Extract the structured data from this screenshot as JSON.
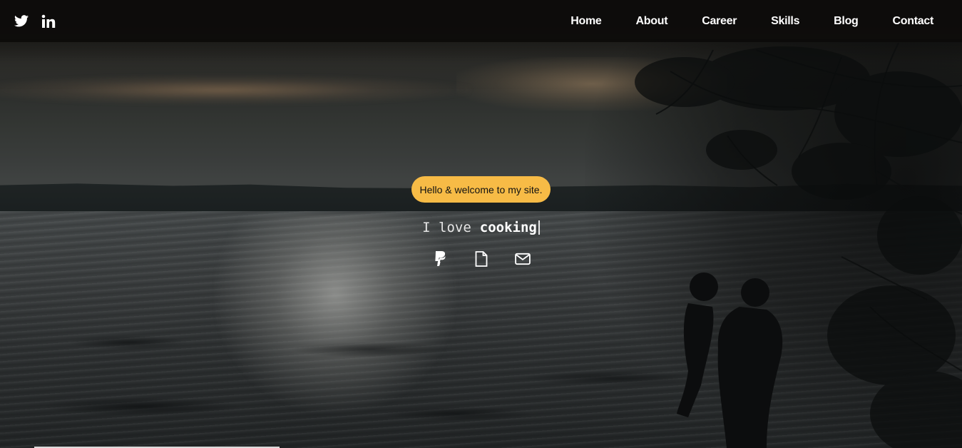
{
  "social": [
    {
      "name": "twitter-icon",
      "label": "Twitter"
    },
    {
      "name": "linkedin-icon",
      "label": "LinkedIn"
    }
  ],
  "nav": {
    "items": [
      {
        "label": "Home"
      },
      {
        "label": "About"
      },
      {
        "label": "Career"
      },
      {
        "label": "Skills"
      },
      {
        "label": "Blog"
      },
      {
        "label": "Contact"
      }
    ]
  },
  "hero": {
    "badge": "Hello & welcome to my site.",
    "typed_prefix": "I love",
    "typed_word": "cooking",
    "icons": [
      {
        "name": "paypal-icon"
      },
      {
        "name": "document-icon"
      },
      {
        "name": "envelope-icon"
      }
    ]
  },
  "colors": {
    "accent": "#f7bb46",
    "navbar": "#0c0b0a",
    "text": "#ffffff"
  }
}
